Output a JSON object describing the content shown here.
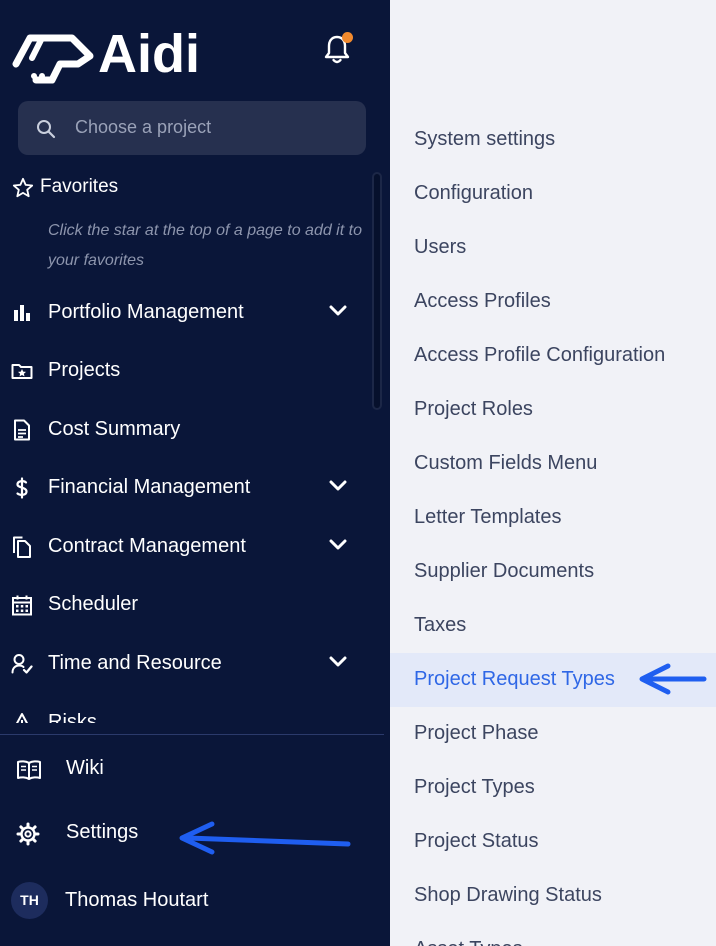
{
  "app": {
    "name": "Aidi"
  },
  "header": {
    "notification_dot_color": "#f28a2e"
  },
  "search": {
    "placeholder": "Choose a project"
  },
  "favorites": {
    "title": "Favorites",
    "hint": "Click the star at the top of a page to add it to your favorites"
  },
  "nav": {
    "items": [
      {
        "label": "Portfolio Management",
        "icon": "bar-chart-icon",
        "expandable": true
      },
      {
        "label": "Projects",
        "icon": "folder-star-icon",
        "expandable": false
      },
      {
        "label": "Cost Summary",
        "icon": "document-icon",
        "expandable": false
      },
      {
        "label": "Financial Management",
        "icon": "dollar-icon",
        "expandable": true
      },
      {
        "label": "Contract Management",
        "icon": "copy-icon",
        "expandable": true
      },
      {
        "label": "Scheduler",
        "icon": "calendar-icon",
        "expandable": false
      },
      {
        "label": "Time and Resource",
        "icon": "user-check-icon",
        "expandable": true
      },
      {
        "label": "Risks",
        "icon": "warning-icon",
        "expandable": false
      }
    ]
  },
  "bottom": {
    "wiki": "Wiki",
    "settings": "Settings",
    "user": {
      "initials": "TH",
      "name": "Thomas Houtart"
    }
  },
  "settings_menu": {
    "active_item": "Project Request Types",
    "items": [
      "System settings",
      "Configuration",
      "Users",
      "Access Profiles",
      "Access Profile Configuration",
      "Project Roles",
      "Custom Fields Menu",
      "Letter Templates",
      "Supplier Documents",
      "Taxes",
      "Project Request Types",
      "Project Phase",
      "Project Types",
      "Project Status",
      "Shop Drawing Status",
      "Asset Types"
    ]
  },
  "colors": {
    "sidebar_bg": "#0a1639",
    "panel_bg": "#f1f2f7",
    "accent": "#2f67e6",
    "annotation_arrow": "#1f5ef0"
  }
}
